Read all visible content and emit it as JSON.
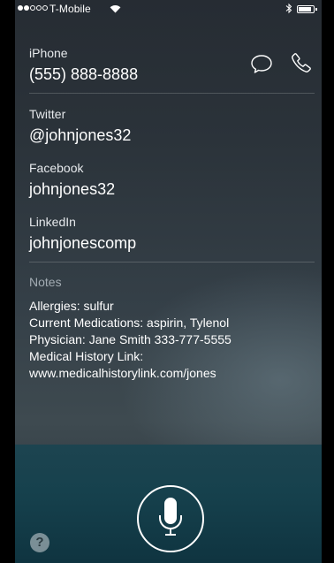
{
  "status_bar": {
    "carrier": "T-Mobile",
    "signal_bars_filled": 2,
    "signal_bars_total": 5
  },
  "contact": {
    "phone": {
      "label": "iPhone",
      "value": "(555) 888-8888"
    },
    "twitter": {
      "label": "Twitter",
      "value": "@johnjones32"
    },
    "facebook": {
      "label": "Facebook",
      "value": "johnjones32"
    },
    "linkedin": {
      "label": "LinkedIn",
      "value": "johnjonescomp"
    }
  },
  "notes": {
    "label": "Notes",
    "lines": [
      "Allergies: sulfur",
      "Current Medications:  aspirin, Tylenol",
      "Physician: Jane Smith 333-777-5555",
      "Medical History Link:",
      "www.medicalhistorylink.com/jones"
    ]
  },
  "help": {
    "glyph": "?"
  },
  "icons": [
    "message-icon",
    "phone-icon",
    "microphone-icon",
    "wifi-icon",
    "bluetooth-icon",
    "battery-icon"
  ]
}
